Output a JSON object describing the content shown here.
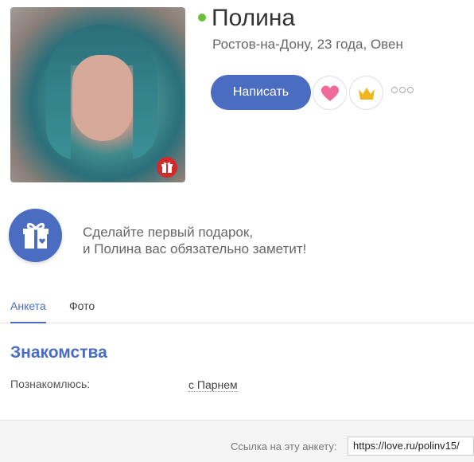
{
  "profile": {
    "name": "Полина",
    "subtitle": "Ростов-на-Дону, 23 года, Овен",
    "status": "online"
  },
  "actions": {
    "write_label": "Написать",
    "like_icon": "heart-icon",
    "vip_icon": "crown-icon",
    "more_icon": "more-dots-icon"
  },
  "gift_promo": {
    "line1": "Сделайте первый подарок,",
    "line2": "и Полина вас обязательно заметит!"
  },
  "tabs": [
    {
      "label": "Анкета",
      "active": true
    },
    {
      "label": "Фото",
      "active": false
    }
  ],
  "section": {
    "title": "Знакомства",
    "fields": [
      {
        "label": "Познакомлюсь:",
        "value": "с Парнем"
      }
    ]
  },
  "footer": {
    "label": "Ссылка на эту анкету:",
    "link": "https://love.ru/polinv15/"
  },
  "colors": {
    "accent": "#4a6cc1",
    "online": "#67c23a",
    "gift_badge": "#d22a2a",
    "heart": "#f06a9a",
    "crown": "#f2b51d"
  }
}
